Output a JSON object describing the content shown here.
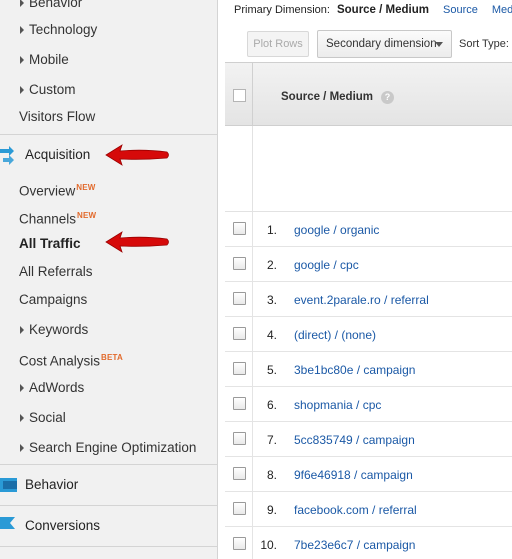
{
  "sidebar": {
    "behavior_partial": "Behavior",
    "technology": "Technology",
    "mobile": "Mobile",
    "custom": "Custom",
    "visitors_flow": "Visitors Flow",
    "acquisition": "Acquisition",
    "overview": "Overview",
    "channels": "Channels",
    "all_traffic": "All Traffic",
    "all_referrals": "All Referrals",
    "campaigns": "Campaigns",
    "keywords": "Keywords",
    "cost_analysis": "Cost Analysis",
    "adwords": "AdWords",
    "social": "Social",
    "seo": "Search Engine Optimization",
    "behavior": "Behavior",
    "conversions": "Conversions",
    "new_badge": "NEW",
    "beta_badge": "BETA"
  },
  "main": {
    "primary_dimension_label": "Primary Dimension:",
    "primary_dimension_current": "Source / Medium",
    "primary_dimension_source": "Source",
    "primary_dimension_medium_partial": "Med",
    "plot_rows": "Plot Rows",
    "secondary_dimension": "Secondary dimension",
    "sort_type": "Sort Type:",
    "column_header": "Source / Medium",
    "help": "?"
  },
  "rows": [
    {
      "num": "1.",
      "src": "google / organic"
    },
    {
      "num": "2.",
      "src": "google / cpc"
    },
    {
      "num": "3.",
      "src": "event.2parale.ro / referral"
    },
    {
      "num": "4.",
      "src": "(direct) / (none)"
    },
    {
      "num": "5.",
      "src": "3be1bc80e / campaign"
    },
    {
      "num": "6.",
      "src": "shopmania / cpc"
    },
    {
      "num": "7.",
      "src": "5cc835749 / campaign"
    },
    {
      "num": "8.",
      "src": "9f6e46918 / campaign"
    },
    {
      "num": "9.",
      "src": "facebook.com / referral"
    },
    {
      "num": "10.",
      "src": "7be23e6c7 / campaign"
    }
  ],
  "colors": {
    "link": "#1b59a6",
    "arrow": "#d60a0a",
    "acquisition_icon": "#2a9ad6",
    "new_badge": "#e26a2c"
  }
}
